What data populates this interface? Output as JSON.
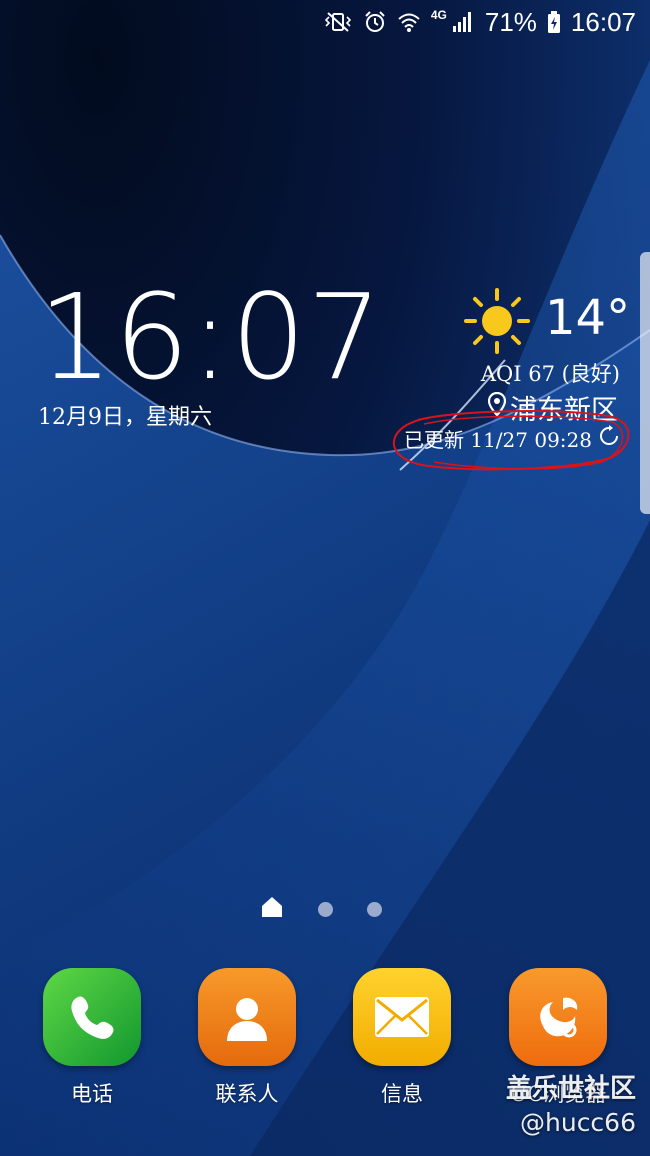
{
  "status_bar": {
    "icons": [
      "vibrate-mute-icon",
      "alarm-icon",
      "wifi-icon",
      "signal-icon",
      "battery-charging-icon"
    ],
    "network": "4G",
    "battery": "71%",
    "time": "16:07"
  },
  "lock_clock": {
    "time": "16:07",
    "date": "12月9日，星期六"
  },
  "weather": {
    "icon": "sun-icon",
    "temperature": "14°",
    "aqi": "AQI 67 (良好)",
    "location": "浦东新区",
    "updated": "已更新 11/27 09:28"
  },
  "pager": {
    "pages": 3,
    "active": 0
  },
  "dock": {
    "apps": [
      {
        "label": "电话",
        "icon": "phone-icon",
        "color": "#2fae37"
      },
      {
        "label": "联系人",
        "icon": "contacts-icon",
        "color": "#f07a14"
      },
      {
        "label": "信息",
        "icon": "message-icon",
        "color": "#f6b400"
      },
      {
        "label": "UC浏览器",
        "icon": "uc-browser-icon",
        "color": "#f27a12"
      }
    ]
  },
  "watermark": {
    "title": "盖乐世社区",
    "handle": "@hucc66"
  },
  "colors": {
    "annotation_red": "#d8141a",
    "sun_yellow": "#f8c81c"
  }
}
